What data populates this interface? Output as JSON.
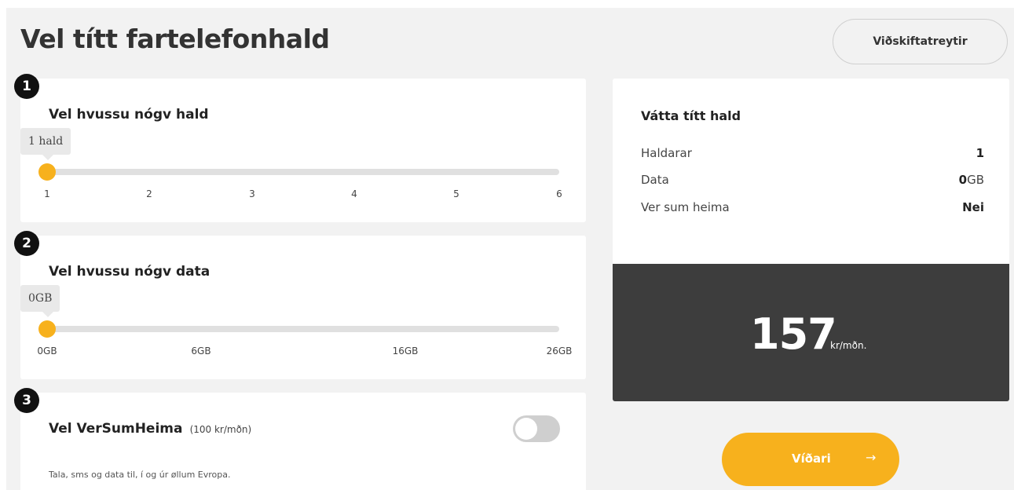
{
  "header": {
    "title": "Vel títt fartelefonhald",
    "terms_button": "Viðskiftatreytir"
  },
  "step1": {
    "badge": "1",
    "title": "Vel hvussu nógv hald",
    "tooltip": "1 hald",
    "ticks": [
      "1",
      "2",
      "3",
      "4",
      "5",
      "6"
    ],
    "selected_index": 0
  },
  "step2": {
    "badge": "2",
    "title": "Vel hvussu nógv data",
    "tooltip": "0GB",
    "ticks": [
      "0GB",
      "6GB",
      "16GB",
      "26GB"
    ],
    "selected_index": 0
  },
  "step3": {
    "badge": "3",
    "title": "Vel VerSumHeima",
    "price_note": "(100 kr/mðn)",
    "description": "Tala, sms og data til, í og úr øllum Evropa.",
    "toggle_on": false
  },
  "summary": {
    "title": "Vátta títt hald",
    "rows": [
      {
        "label": "Haldarar",
        "value": "1",
        "unit": ""
      },
      {
        "label": "Data",
        "value": "0",
        "unit": "GB"
      },
      {
        "label": "Ver sum heima",
        "value": "Nei",
        "unit": ""
      }
    ],
    "price": "157",
    "price_unit": "kr/mðn."
  },
  "actions": {
    "next_label": "Víðari",
    "next_arrow": "→"
  },
  "colors": {
    "accent": "#f7b11d",
    "dark_panel": "#3d3d3d",
    "background": "#f2f2f2"
  }
}
